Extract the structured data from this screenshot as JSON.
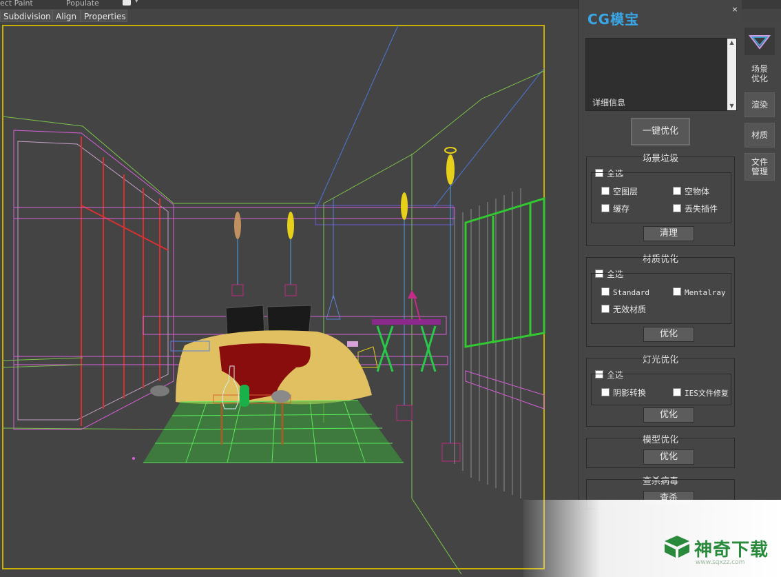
{
  "toolbar": {
    "item_object_paint": "ect Paint",
    "item_populate": "Populate"
  },
  "ribbon_tabs": [
    "Subdivision",
    "Align",
    "Properties"
  ],
  "panel": {
    "logo": "CG模宝",
    "close_glyph": "×",
    "info_label": "详细信息",
    "optimize_all_label": "一键优化",
    "groups": {
      "scene_junk": {
        "title": "场景垃圾",
        "select_all": "全选",
        "options": [
          "空图层",
          "空物体",
          "缓存",
          "丢失插件"
        ],
        "action": "清理"
      },
      "material": {
        "title": "材质优化",
        "select_all": "全选",
        "options": [
          "Standard",
          "Mentalray",
          "无效材质"
        ],
        "action": "优化"
      },
      "light": {
        "title": "灯光优化",
        "select_all": "全选",
        "options": [
          "阴影转换",
          "IES文件修复"
        ],
        "action": "优化"
      },
      "model": {
        "title": "模型优化",
        "action": "优化"
      },
      "virus": {
        "title": "查杀病毒",
        "action": "查杀"
      }
    }
  },
  "side_tabs": [
    "场景优化",
    "渲染",
    "材质",
    "文件管理"
  ],
  "watermark": {
    "text": "神奇下载",
    "url": "www.sqxzz.com"
  },
  "colors": {
    "logo": "#39a6e6",
    "viewport_border": "#c8b000",
    "watermark": "#2a8a3c"
  }
}
